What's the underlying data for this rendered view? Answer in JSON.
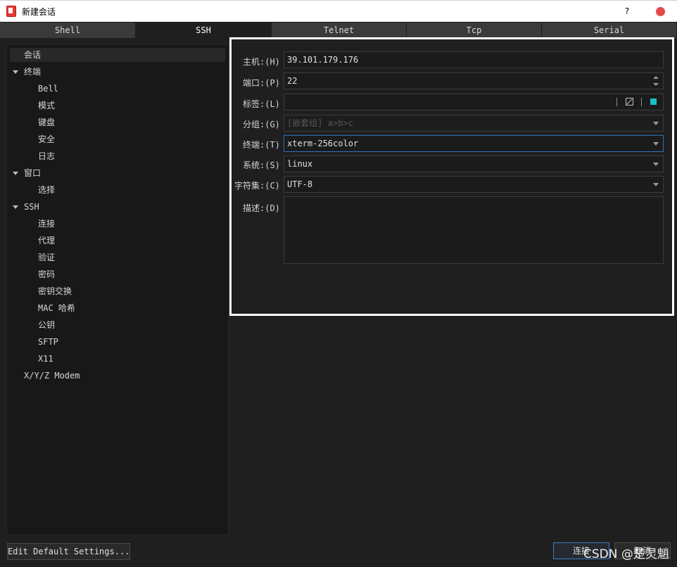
{
  "window": {
    "title": "新建会话",
    "help_label": "?"
  },
  "tabs": [
    {
      "label": "Shell",
      "active": false
    },
    {
      "label": "SSH",
      "active": true
    },
    {
      "label": "Telnet",
      "active": false
    },
    {
      "label": "Tcp",
      "active": false
    },
    {
      "label": "Serial",
      "active": false
    }
  ],
  "tree": {
    "session": "会话",
    "terminal": "终端",
    "terminal_children": [
      "Bell",
      "模式",
      "键盘",
      "安全",
      "日志"
    ],
    "window": "窗口",
    "window_children": [
      "选择"
    ],
    "ssh": "SSH",
    "ssh_children": [
      "连接",
      "代理",
      "验证",
      "密码",
      "密钥交换",
      "MAC 哈希",
      "公钥",
      "SFTP",
      "X11"
    ],
    "modem": "X/Y/Z Modem"
  },
  "form": {
    "host_label": "主机:(H)",
    "host_value": "39.101.179.176",
    "port_label": "端口:(P)",
    "port_value": "22",
    "tag_label": "标签:(L)",
    "tag_value": "",
    "group_label": "分组:(G)",
    "group_placeholder": "[嵌套组] a>b>c",
    "terminal_label": "终端:(T)",
    "terminal_value": "xterm-256color",
    "system_label": "系统:(S)",
    "system_value": "linux",
    "charset_label": "字符集:(C)",
    "charset_value": "UTF-8",
    "desc_label": "描述:(D)",
    "desc_value": ""
  },
  "buttons": {
    "edit_defaults": "Edit Default Settings...",
    "connect": "连接",
    "cancel": "取消"
  },
  "watermark": "CSDN @楚灵魈",
  "colors": {
    "tag_color": "#19c2c8",
    "close_button": "#e6484c",
    "focus_border": "#2f6fb8"
  }
}
